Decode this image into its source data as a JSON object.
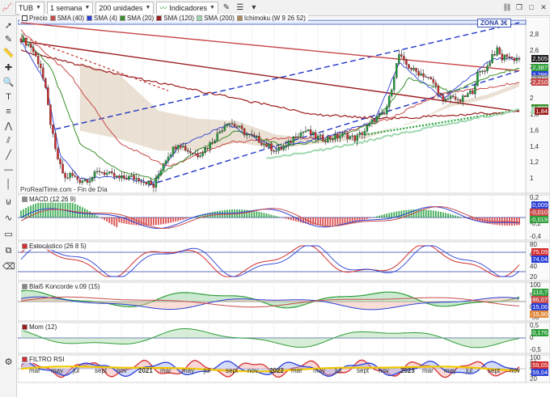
{
  "toolbar": {
    "symbol": "TUB",
    "timeframe": "1 semana",
    "units": "200 unidades",
    "indicators_label": "Indicadores"
  },
  "legend": {
    "price": "Precio",
    "sma40": "SMA (40)",
    "sma4": "SMA (4)",
    "sma20": "SMA (20)",
    "sma120": "SMA (120)",
    "sma200": "SMA (200)",
    "ichimoku": "Ichimoku (W 9 26 52)"
  },
  "brand_text": "ProRealTime.com - Fin de Día",
  "zona_label": "ZONA 3€",
  "colors": {
    "up": "#1f9e3a",
    "down": "#d32f2f",
    "sma40": "#c84a4a",
    "sma4": "#2a3fd6",
    "sma20": "#3a8f2a",
    "sma120": "#9c1d1d",
    "sma200": "#9fd8b0",
    "accent": "#2b3fa0"
  },
  "price_axis": [
    "2,8",
    "2,6",
    "2,4",
    "2,2",
    "2",
    "1,8",
    "1,6",
    "1,4",
    "1,2",
    "1"
  ],
  "price_tags": [
    {
      "text": "2,505",
      "color": "#1c1c1c"
    },
    {
      "text": "2,387",
      "color": "#2e9e3a"
    },
    {
      "text": "2,296",
      "color": "#2a3fd6"
    },
    {
      "text": "2,248",
      "color": "#8a8a8a"
    },
    {
      "text": "2,210",
      "color": "#c84a4a"
    },
    {
      "text": "1,889",
      "color": "#3a8f2a"
    },
    {
      "text": "1,859",
      "color": "#9fd8b0"
    },
    {
      "text": "1,84",
      "color": "#9c1d1d"
    }
  ],
  "panels": [
    {
      "id": "macd",
      "title": "MACD (12 26 9)",
      "axis": [
        "0,2",
        "0",
        "-0,2",
        "-0,4"
      ],
      "tags": [
        "0,009",
        "-0,010",
        "-0,019"
      ]
    },
    {
      "id": "stoch",
      "title": "Estocástico (26 8 5)",
      "axis": [
        "80",
        "60",
        "40",
        "20"
      ],
      "tags": [
        "75,09",
        "74,04"
      ]
    },
    {
      "id": "blai5",
      "title": "Blai5 Koncorde v.09 (15)",
      "axis": [
        "100",
        "50",
        "0",
        "-50"
      ],
      "tags": [
        "110,7",
        "86,07",
        "15,06",
        "-15,90"
      ]
    },
    {
      "id": "mom",
      "title": "Mom (12)",
      "axis": [
        "0,5",
        "0",
        "-0,5"
      ],
      "tags": [
        "0,176"
      ]
    },
    {
      "id": "rsi",
      "title": "FILTRO RSI",
      "axis": [
        "100",
        "80",
        "60",
        "40",
        "20"
      ],
      "tags": [
        "59,05",
        "59,04"
      ]
    }
  ],
  "months": [
    {
      "t": "mar",
      "year": false
    },
    {
      "t": "may",
      "year": false
    },
    {
      "t": "jul",
      "year": false
    },
    {
      "t": "sept",
      "year": false
    },
    {
      "t": "nov",
      "year": false
    },
    {
      "t": "2021",
      "year": true
    },
    {
      "t": "mar",
      "year": false
    },
    {
      "t": "may",
      "year": false
    },
    {
      "t": "jul",
      "year": false
    },
    {
      "t": "sept",
      "year": false
    },
    {
      "t": "nov",
      "year": false
    },
    {
      "t": "2022",
      "year": true
    },
    {
      "t": "mar",
      "year": false
    },
    {
      "t": "may",
      "year": false
    },
    {
      "t": "jul",
      "year": false
    },
    {
      "t": "sept",
      "year": false
    },
    {
      "t": "nov",
      "year": false
    },
    {
      "t": "2023",
      "year": true
    },
    {
      "t": "mar",
      "year": false
    },
    {
      "t": "may",
      "year": false
    },
    {
      "t": "jul",
      "year": false
    },
    {
      "t": "sept",
      "year": false
    },
    {
      "t": "nov",
      "year": false
    }
  ],
  "chart_data": {
    "type": "candlestick",
    "title": "TUB",
    "timeframe": "1 semana",
    "price_range": [
      0.9,
      2.9
    ],
    "price_path": [
      [
        0,
        2.75
      ],
      [
        4,
        2.65
      ],
      [
        8,
        2.4
      ],
      [
        10,
        2.1
      ],
      [
        12,
        1.7
      ],
      [
        14,
        1.35
      ],
      [
        16,
        1.15
      ],
      [
        18,
        1.0
      ],
      [
        20,
        1.05
      ],
      [
        24,
        0.98
      ],
      [
        28,
        1.0
      ],
      [
        32,
        1.1
      ],
      [
        36,
        1.05
      ],
      [
        40,
        1.0
      ],
      [
        44,
        1.02
      ],
      [
        48,
        1.0
      ],
      [
        52,
        0.95
      ],
      [
        54,
        0.9
      ],
      [
        56,
        1.05
      ],
      [
        58,
        1.2
      ],
      [
        60,
        1.3
      ],
      [
        64,
        1.45
      ],
      [
        68,
        1.35
      ],
      [
        72,
        1.3
      ],
      [
        76,
        1.4
      ],
      [
        80,
        1.55
      ],
      [
        84,
        1.72
      ],
      [
        88,
        1.65
      ],
      [
        92,
        1.55
      ],
      [
        96,
        1.5
      ],
      [
        100,
        1.42
      ],
      [
        104,
        1.35
      ],
      [
        108,
        1.4
      ],
      [
        112,
        1.55
      ],
      [
        116,
        1.6
      ],
      [
        120,
        1.52
      ],
      [
        124,
        1.5
      ],
      [
        128,
        1.52
      ],
      [
        132,
        1.55
      ],
      [
        136,
        1.5
      ],
      [
        140,
        1.6
      ],
      [
        144,
        1.75
      ],
      [
        148,
        1.8
      ],
      [
        150,
        2.0
      ],
      [
        152,
        2.3
      ],
      [
        154,
        2.55
      ],
      [
        156,
        2.45
      ],
      [
        160,
        2.35
      ],
      [
        164,
        2.3
      ],
      [
        168,
        2.2
      ],
      [
        170,
        2.1
      ],
      [
        172,
        1.95
      ],
      [
        174,
        2.0
      ],
      [
        176,
        2.05
      ],
      [
        178,
        1.95
      ],
      [
        180,
        2.0
      ],
      [
        184,
        2.1
      ],
      [
        186,
        2.3
      ],
      [
        188,
        2.35
      ],
      [
        190,
        2.4
      ],
      [
        192,
        2.55
      ],
      [
        194,
        2.6
      ],
      [
        196,
        2.5
      ],
      [
        198,
        2.55
      ],
      [
        200,
        2.5
      ],
      [
        203,
        2.505
      ]
    ],
    "sma4": [
      [
        0,
        2.72
      ],
      [
        10,
        2.2
      ],
      [
        16,
        1.3
      ],
      [
        24,
        1.0
      ],
      [
        40,
        1.02
      ],
      [
        54,
        0.95
      ],
      [
        64,
        1.4
      ],
      [
        84,
        1.68
      ],
      [
        104,
        1.38
      ],
      [
        124,
        1.52
      ],
      [
        144,
        1.72
      ],
      [
        154,
        2.45
      ],
      [
        172,
        2.0
      ],
      [
        192,
        2.5
      ],
      [
        203,
        2.5
      ]
    ],
    "sma20": [
      [
        0,
        2.8
      ],
      [
        12,
        2.4
      ],
      [
        24,
        1.45
      ],
      [
        40,
        1.1
      ],
      [
        54,
        1.0
      ],
      [
        72,
        1.35
      ],
      [
        88,
        1.6
      ],
      [
        108,
        1.4
      ],
      [
        128,
        1.52
      ],
      [
        144,
        1.7
      ],
      [
        158,
        2.25
      ],
      [
        176,
        2.08
      ],
      [
        192,
        2.3
      ],
      [
        203,
        2.39
      ]
    ],
    "sma40": [
      [
        0,
        2.85
      ],
      [
        20,
        2.3
      ],
      [
        40,
        1.45
      ],
      [
        60,
        1.15
      ],
      [
        84,
        1.45
      ],
      [
        104,
        1.5
      ],
      [
        124,
        1.52
      ],
      [
        150,
        1.75
      ],
      [
        170,
        2.05
      ],
      [
        192,
        2.15
      ],
      [
        203,
        2.21
      ]
    ],
    "sma120": [
      [
        0,
        2.6
      ],
      [
        40,
        2.3
      ],
      [
        80,
        2.05
      ],
      [
        120,
        1.8
      ],
      [
        150,
        1.75
      ],
      [
        180,
        1.8
      ],
      [
        203,
        1.84
      ]
    ],
    "sma200": [
      [
        100,
        1.25
      ],
      [
        130,
        1.4
      ],
      [
        160,
        1.6
      ],
      [
        185,
        1.75
      ],
      [
        203,
        1.86
      ]
    ],
    "trendlines": [
      {
        "name": "upper-channel",
        "from": [
          14,
          1.62
        ],
        "to": [
          203,
          2.95
        ],
        "style": "dashed",
        "color": "#2236c4"
      },
      {
        "name": "lower-channel",
        "from": [
          52,
          0.92
        ],
        "to": [
          203,
          2.35
        ],
        "style": "dashed",
        "color": "#2236c4"
      },
      {
        "name": "resistance",
        "from": [
          0,
          2.95
        ],
        "to": [
          203,
          2.35
        ],
        "style": "solid",
        "color": "#c84a4a"
      },
      {
        "name": "descending",
        "from": [
          0,
          2.72
        ],
        "to": [
          203,
          1.84
        ],
        "style": "solid",
        "color": "#9c1d1d"
      },
      {
        "name": "support",
        "from": [
          140,
          1.55
        ],
        "to": [
          203,
          1.86
        ],
        "style": "dotted",
        "color": "#28a33b"
      }
    ],
    "zona_level": 2.95
  }
}
